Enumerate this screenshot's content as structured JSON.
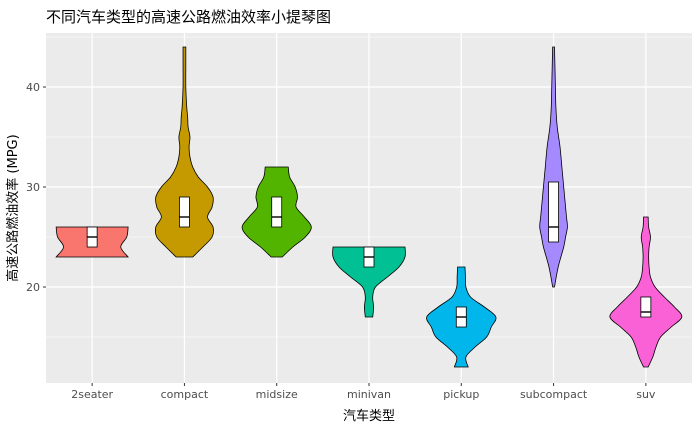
{
  "chart_data": {
    "type": "violin",
    "title": "不同汽车类型的高速公路燃油效率小提琴图",
    "xlabel": "汽车类型",
    "ylabel": "高速公路燃油效率 (MPG)",
    "ylim": [
      10.4,
      45.4
    ],
    "yticks": [
      20,
      30,
      40
    ],
    "grid": true,
    "legend": "none",
    "categories": [
      "2seater",
      "compact",
      "midsize",
      "minivan",
      "pickup",
      "subcompact",
      "suv"
    ],
    "series": [
      {
        "category": "2seater",
        "color": "#F8766D",
        "min": 23,
        "max": 26,
        "q1": 24,
        "median": 25,
        "q3": 26,
        "profile": [
          [
            23,
            0.78
          ],
          [
            24,
            0.62
          ],
          [
            25,
            0.75
          ],
          [
            26,
            0.78
          ]
        ]
      },
      {
        "category": "compact",
        "color": "#C49A00",
        "min": 23,
        "max": 44,
        "q1": 26,
        "median": 27,
        "q3": 29,
        "profile": [
          [
            23,
            0.18
          ],
          [
            24,
            0.4
          ],
          [
            25,
            0.6
          ],
          [
            26,
            0.62
          ],
          [
            27,
            0.5
          ],
          [
            28,
            0.6
          ],
          [
            29,
            0.62
          ],
          [
            30,
            0.5
          ],
          [
            31,
            0.3
          ],
          [
            32,
            0.18
          ],
          [
            33,
            0.12
          ],
          [
            34,
            0.1
          ],
          [
            35,
            0.12
          ],
          [
            36,
            0.08
          ],
          [
            37,
            0.07
          ],
          [
            38,
            0.05
          ],
          [
            40,
            0.03
          ],
          [
            42,
            0.03
          ],
          [
            44,
            0.03
          ]
        ]
      },
      {
        "category": "midsize",
        "color": "#53B400",
        "min": 23,
        "max": 32,
        "q1": 26,
        "median": 27,
        "q3": 29,
        "profile": [
          [
            23,
            0.12
          ],
          [
            24,
            0.35
          ],
          [
            25,
            0.62
          ],
          [
            26,
            0.75
          ],
          [
            27,
            0.6
          ],
          [
            28,
            0.42
          ],
          [
            29,
            0.45
          ],
          [
            30,
            0.4
          ],
          [
            31,
            0.28
          ],
          [
            32,
            0.25
          ]
        ]
      },
      {
        "category": "minivan",
        "color": "#00C094",
        "min": 17,
        "max": 24,
        "q1": 22,
        "median": 23,
        "q3": 24,
        "profile": [
          [
            17,
            0.08
          ],
          [
            18,
            0.1
          ],
          [
            19,
            0.08
          ],
          [
            20,
            0.14
          ],
          [
            21,
            0.4
          ],
          [
            22,
            0.65
          ],
          [
            23,
            0.78
          ],
          [
            24,
            0.78
          ]
        ]
      },
      {
        "category": "pickup",
        "color": "#00B6EB",
        "min": 12,
        "max": 22,
        "q1": 16,
        "median": 17,
        "q3": 18,
        "profile": [
          [
            12,
            0.15
          ],
          [
            13,
            0.1
          ],
          [
            14,
            0.3
          ],
          [
            15,
            0.55
          ],
          [
            16,
            0.65
          ],
          [
            17,
            0.75
          ],
          [
            18,
            0.5
          ],
          [
            19,
            0.2
          ],
          [
            20,
            0.1
          ],
          [
            21,
            0.09
          ],
          [
            22,
            0.08
          ]
        ]
      },
      {
        "category": "subcompact",
        "color": "#A58AFF",
        "min": 20,
        "max": 44,
        "q1": 24.5,
        "median": 26,
        "q3": 30.5,
        "profile": [
          [
            20,
            0.02
          ],
          [
            22,
            0.1
          ],
          [
            24,
            0.22
          ],
          [
            25,
            0.26
          ],
          [
            26,
            0.3
          ],
          [
            27,
            0.28
          ],
          [
            28,
            0.26
          ],
          [
            29,
            0.24
          ],
          [
            30,
            0.22
          ],
          [
            32,
            0.18
          ],
          [
            34,
            0.14
          ],
          [
            36,
            0.08
          ],
          [
            38,
            0.05
          ],
          [
            40,
            0.04
          ],
          [
            42,
            0.03
          ],
          [
            44,
            0.02
          ]
        ]
      },
      {
        "category": "suv",
        "color": "#FB61D7",
        "min": 12,
        "max": 27,
        "q1": 17,
        "median": 17.5,
        "q3": 19,
        "profile": [
          [
            12,
            0.05
          ],
          [
            13,
            0.15
          ],
          [
            14,
            0.22
          ],
          [
            15,
            0.32
          ],
          [
            16,
            0.55
          ],
          [
            17,
            0.78
          ],
          [
            18,
            0.62
          ],
          [
            19,
            0.4
          ],
          [
            20,
            0.2
          ],
          [
            21,
            0.1
          ],
          [
            22,
            0.07
          ],
          [
            23,
            0.06
          ],
          [
            24,
            0.07
          ],
          [
            25,
            0.1
          ],
          [
            26,
            0.06
          ],
          [
            27,
            0.05
          ]
        ]
      }
    ]
  }
}
